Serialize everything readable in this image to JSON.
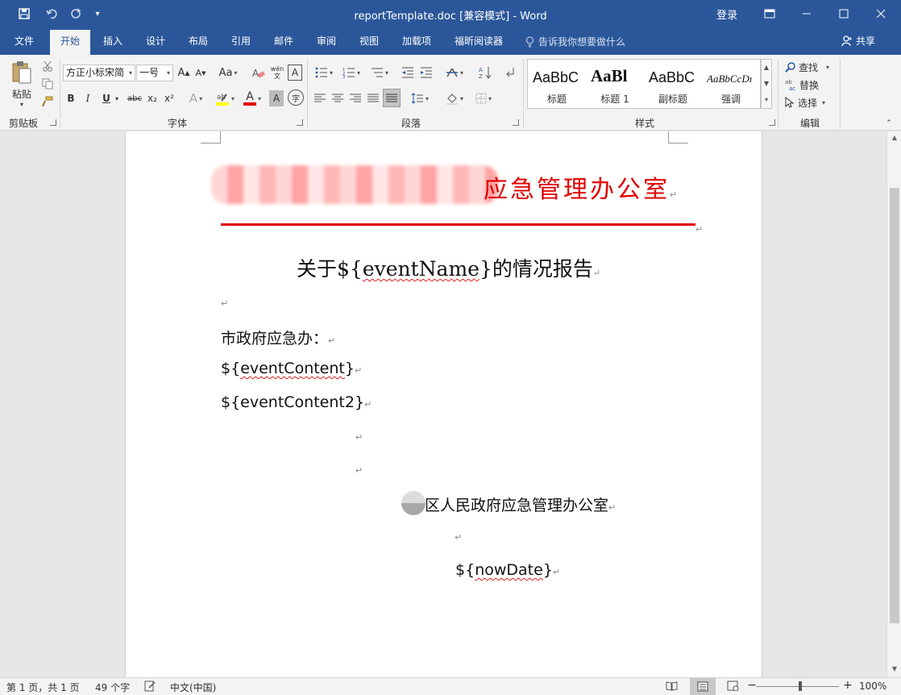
{
  "titlebar": {
    "title": "reportTemplate.doc [兼容模式]  -  Word",
    "login": "登录",
    "save_icon": "save-icon",
    "undo_icon": "undo-icon",
    "redo_icon": "redo-icon"
  },
  "tabs": [
    "文件",
    "开始",
    "插入",
    "设计",
    "布局",
    "引用",
    "邮件",
    "审阅",
    "视图",
    "加载项",
    "福昕阅读器"
  ],
  "active_tab": "开始",
  "tell_me": "告诉我你想要做什么",
  "share": "共享",
  "ribbon": {
    "clipboard": {
      "paste": "粘贴",
      "group": "剪贴板"
    },
    "font": {
      "group": "字体",
      "font_name": "方正小标宋简",
      "font_size": "一号",
      "grow": "A",
      "shrink": "A",
      "change_case": "Aa",
      "phonetic": "wén",
      "bold": "B",
      "italic": "I",
      "underline": "U",
      "strike": "abc",
      "subscript": "x₂",
      "superscript": "x²",
      "text_effect": "A",
      "font_color": "A",
      "char_shading": "A",
      "enclose": "字"
    },
    "paragraph": {
      "group": "段落"
    },
    "styles": {
      "group": "样式",
      "items": [
        {
          "sample": "AaBbC",
          "name": "标题"
        },
        {
          "sample": "AaBl",
          "name": "标题 1"
        },
        {
          "sample": "AaBbC",
          "name": "副标题"
        },
        {
          "sample": "AaBbCcDı",
          "name": "强调"
        }
      ]
    },
    "editing": {
      "group": "编辑",
      "find": "查找",
      "replace": "替换",
      "select": "选择"
    }
  },
  "document": {
    "header_org": "应急管理办公室",
    "heading_prefix": "关于${",
    "heading_var": "eventName",
    "heading_suffix": "}的情况报告",
    "salutation": "市政府应急办：",
    "content1_prefix": "${",
    "content1_var": "eventContent",
    "content1_suffix": "}",
    "content2": "${eventContent2}",
    "signature": "区人民政府应急管理办公室",
    "date_prefix": "${",
    "date_var": "nowDate",
    "date_suffix": "}",
    "paragraph_mark": "↵"
  },
  "statusbar": {
    "pages": "第 1 页，共 1 页",
    "words": "49 个字",
    "language": "中文(中国)",
    "zoom": "100%",
    "zoom_minus": "−",
    "zoom_plus": "+"
  },
  "colors": {
    "brand": "#2b579a",
    "header_red": "#e00000"
  }
}
